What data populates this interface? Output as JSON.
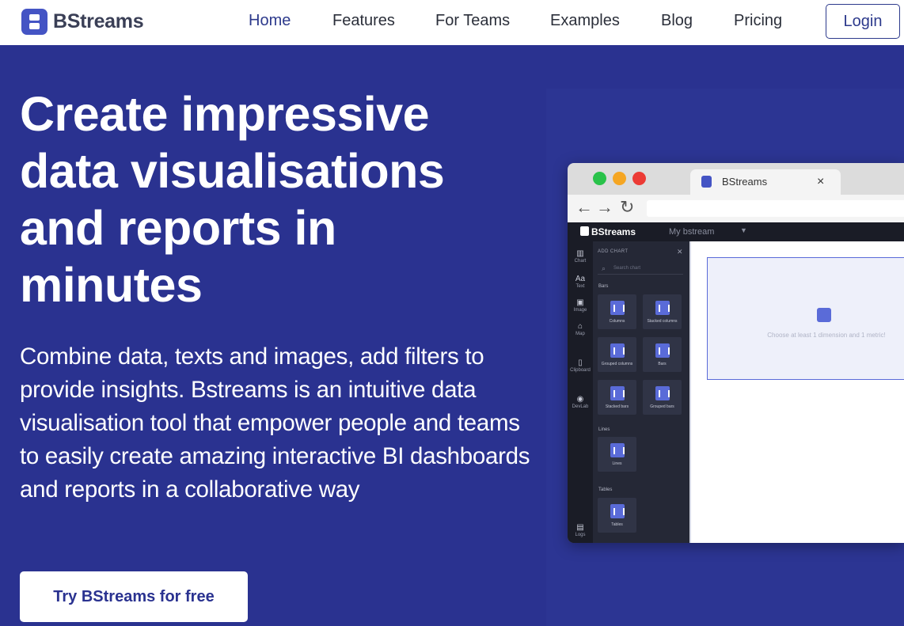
{
  "nav": {
    "brand": "BStreams",
    "links": [
      "Home",
      "Features",
      "For Teams",
      "Examples",
      "Blog",
      "Pricing"
    ],
    "login": "Login"
  },
  "hero": {
    "title": "Create impressive data visualisations and reports in minutes",
    "description": "Combine data, texts and images, add filters to provide insights. Bstreams is an intuitive data visualisation tool that empower people and teams to easily create amazing interactive BI dashboards and reports in a collaborative way",
    "cta": "Try BStreams for free"
  },
  "preview": {
    "browser_tab": "BStreams",
    "tab_close": "×",
    "app_brand": "BStreams",
    "app_stream": "My bstream",
    "rail": [
      "Chart",
      "Text",
      "Image",
      "Map",
      "Clipboard",
      "DevLab",
      "Logs"
    ],
    "panel_title": "ADD CHART",
    "search_placeholder": "Search chart",
    "sections": [
      "Bars",
      "Lines",
      "Tables"
    ],
    "tiles": [
      "Columns",
      "Stacked columns",
      "Grouped columns",
      "Bars",
      "Stacked bars",
      "Grouped bars",
      "Lines",
      "Tables"
    ],
    "canvas_hint": "Choose at least 1 dimension and 1 metric!"
  },
  "colors": {
    "hero_bg": "#2a3290",
    "brand_accent": "#4454c4",
    "window_dots": [
      "#29c24a",
      "#f5a623",
      "#ec3b35"
    ]
  }
}
